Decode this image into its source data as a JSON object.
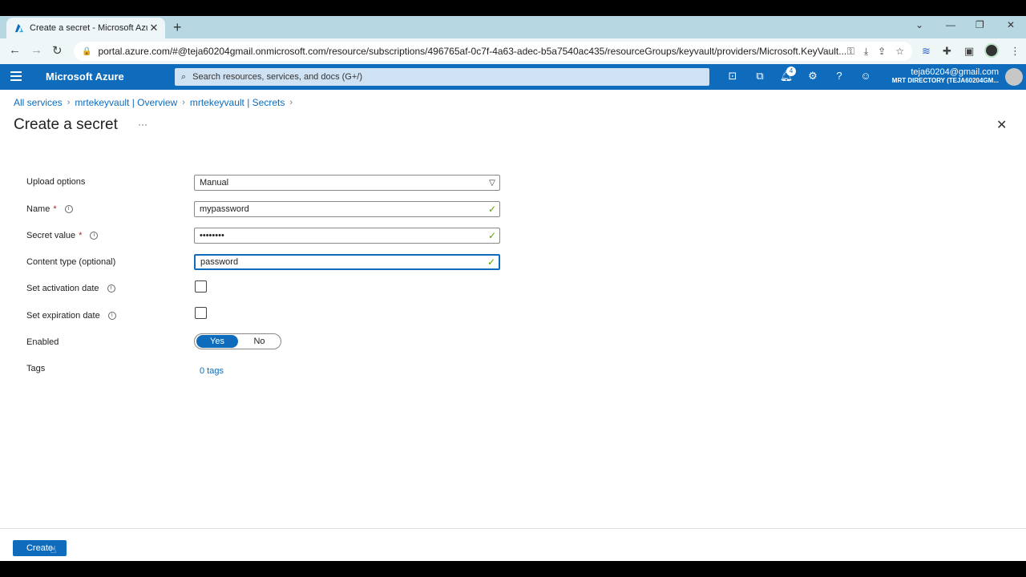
{
  "browser": {
    "tab_title": "Create a secret - Microsoft Azure",
    "new_tab": "+",
    "url": "portal.azure.com/#@teja60204gmail.onmicrosoft.com/resource/subscriptions/496765af-0c7f-4a63-adec-b5a7540ac435/resourceGroups/keyvault/providers/Microsoft.KeyVault..."
  },
  "header": {
    "brand": "Microsoft Azure",
    "search_placeholder": "Search resources, services, and docs (G+/)",
    "notification_count": "4",
    "account_email": "teja60204@gmail.com",
    "account_directory": "MRT DIRECTORY (TEJA60204GM..."
  },
  "breadcrumb": {
    "items": [
      "All services",
      "mrtekeyvault | Overview",
      "mrtekeyvault | Secrets"
    ]
  },
  "page": {
    "title": "Create a secret",
    "more": "···"
  },
  "form": {
    "upload_label": "Upload options",
    "upload_value": "Manual",
    "name_label": "Name",
    "name_value": "mypassword",
    "secret_label": "Secret value",
    "secret_value": "••••••••",
    "content_type_label": "Content type (optional)",
    "content_type_value": "password",
    "activation_label": "Set activation date",
    "expiration_label": "Set expiration date",
    "enabled_label": "Enabled",
    "enabled_yes": "Yes",
    "enabled_no": "No",
    "tags_label": "Tags",
    "tags_link": "0 tags",
    "required_mark": "*"
  },
  "footer": {
    "create_label": "Create"
  },
  "colors": {
    "azure_blue": "#0f6cbd",
    "valid_green": "#57a300"
  }
}
